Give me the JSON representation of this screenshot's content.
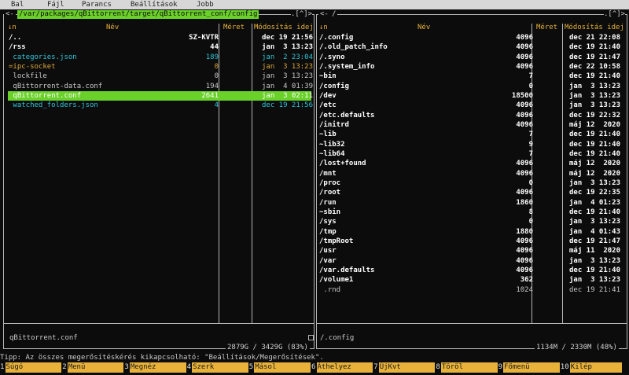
{
  "menu": [
    "Bal",
    "Fájl",
    "Parancs",
    "Beállítások",
    "Jobb"
  ],
  "left": {
    "path": "/var/packages/qBittorrent/target/qBittorrent_conf/config",
    "corner": ".[^]>",
    "prefix_arrow": "<-",
    "headers": {
      "sort": "↓n",
      "name": "Név",
      "size": "Méret",
      "mtime": "Módosítás idej"
    },
    "rows": [
      {
        "name": "/..",
        "size": "SZ-KVTR",
        "mtime": "dec 19 21:56",
        "kind": "dir"
      },
      {
        "name": "/rss",
        "size": "44",
        "mtime": "jan  3 13:23",
        "kind": "dir"
      },
      {
        "name": " categories.json",
        "size": "189",
        "mtime": "jan  2 23:04",
        "kind": "cyan"
      },
      {
        "name": "=ipc-socket",
        "size": "0",
        "mtime": "jan  3 13:23",
        "kind": "yellow"
      },
      {
        "name": " lockfile",
        "size": "0",
        "mtime": "jan  3 13:23",
        "kind": "plain"
      },
      {
        "name": " qBittorrent-data.conf",
        "size": "194",
        "mtime": "jan  4 01:39",
        "kind": "plain"
      },
      {
        "name": " qBittorrent.conf",
        "size": "2641",
        "mtime": "jan  3 02:11",
        "kind": "selected"
      },
      {
        "name": " watched_folders.json",
        "size": "4",
        "mtime": "dec 19 21:56",
        "kind": "cyan"
      }
    ],
    "mini_status": "qBittorrent.conf",
    "free": "2879G / 3429G (83%)"
  },
  "right": {
    "path": "/",
    "prefix_arrow": "<-",
    "corner": ".[^]>",
    "headers": {
      "sort": "↓n",
      "name": "Név",
      "size": "Méret",
      "mtime": "Módosítás idej"
    },
    "rows": [
      {
        "name": "/.config",
        "size": "4096",
        "mtime": "dec 21 22:08",
        "kind": "dir"
      },
      {
        "name": "/.old_patch_info",
        "size": "4096",
        "mtime": "dec 19 21:40",
        "kind": "dir"
      },
      {
        "name": "/.syno",
        "size": "4096",
        "mtime": "dec 19 21:47",
        "kind": "dir"
      },
      {
        "name": "/.system_info",
        "size": "4096",
        "mtime": "dec 22 10:58",
        "kind": "dir"
      },
      {
        "name": "~bin",
        "size": "7",
        "mtime": "dec 19 21:40",
        "kind": "dir"
      },
      {
        "name": "/config",
        "size": "0",
        "mtime": "jan  3 13:23",
        "kind": "dir"
      },
      {
        "name": "/dev",
        "size": "18500",
        "mtime": "jan  3 13:23",
        "kind": "dir"
      },
      {
        "name": "/etc",
        "size": "4096",
        "mtime": "jan  3 13:23",
        "kind": "dir"
      },
      {
        "name": "/etc.defaults",
        "size": "4096",
        "mtime": "dec 19 22:32",
        "kind": "dir"
      },
      {
        "name": "/initrd",
        "size": "4096",
        "mtime": "máj 12  2020",
        "kind": "dir"
      },
      {
        "name": "~lib",
        "size": "7",
        "mtime": "dec 19 21:40",
        "kind": "dir"
      },
      {
        "name": "~lib32",
        "size": "9",
        "mtime": "dec 19 21:40",
        "kind": "dir"
      },
      {
        "name": "~lib64",
        "size": "7",
        "mtime": "dec 19 21:40",
        "kind": "dir"
      },
      {
        "name": "/lost+found",
        "size": "4096",
        "mtime": "máj 12  2020",
        "kind": "dir"
      },
      {
        "name": "/mnt",
        "size": "4096",
        "mtime": "máj 12  2020",
        "kind": "dir"
      },
      {
        "name": "/proc",
        "size": "0",
        "mtime": "jan  3 13:23",
        "kind": "dir"
      },
      {
        "name": "/root",
        "size": "4096",
        "mtime": "dec 19 22:35",
        "kind": "dir"
      },
      {
        "name": "/run",
        "size": "1860",
        "mtime": "jan  4 01:23",
        "kind": "dir"
      },
      {
        "name": "~sbin",
        "size": "8",
        "mtime": "dec 19 21:40",
        "kind": "dir"
      },
      {
        "name": "/sys",
        "size": "0",
        "mtime": "jan  3 13:23",
        "kind": "dir"
      },
      {
        "name": "/tmp",
        "size": "1880",
        "mtime": "jan  4 01:43",
        "kind": "dir"
      },
      {
        "name": "/tmpRoot",
        "size": "4096",
        "mtime": "dec 19 21:47",
        "kind": "dir"
      },
      {
        "name": "/usr",
        "size": "4096",
        "mtime": "máj 11  2020",
        "kind": "dir"
      },
      {
        "name": "/var",
        "size": "4096",
        "mtime": "jan  3 13:23",
        "kind": "dir"
      },
      {
        "name": "/var.defaults",
        "size": "4096",
        "mtime": "dec 19 21:40",
        "kind": "dir"
      },
      {
        "name": "/volume1",
        "size": "362",
        "mtime": "jan  3 13:23",
        "kind": "dir"
      },
      {
        "name": " .rnd",
        "size": "1024",
        "mtime": "dec 19 21:41",
        "kind": "plain"
      }
    ],
    "mini_status": "/.config",
    "free": "1134M / 2330M (48%)"
  },
  "hint": "Tipp: Az összes megerősítéskérés kikapcsolható: \"Beállítások/Megerősítések\".",
  "fkeys": [
    {
      "num": "1",
      "label": "Súgó"
    },
    {
      "num": "2",
      "label": "Menü"
    },
    {
      "num": "3",
      "label": "Megnéz"
    },
    {
      "num": "4",
      "label": "Szerk"
    },
    {
      "num": "5",
      "label": "Másol"
    },
    {
      "num": "6",
      "label": "Áthelyez"
    },
    {
      "num": "7",
      "label": "ÚjKvt"
    },
    {
      "num": "8",
      "label": "Töröl"
    },
    {
      "num": "9",
      "label": "Főmenü"
    },
    {
      "num": "10",
      "label": "Kilép"
    }
  ],
  "colors": {
    "selection": "#6ad12a",
    "directory": "#ffffff",
    "executable_json": "#2ec4d6",
    "socket": "#d9a73a",
    "header": "#e8b23a",
    "fkey_label_bg": "#e8b23a"
  }
}
